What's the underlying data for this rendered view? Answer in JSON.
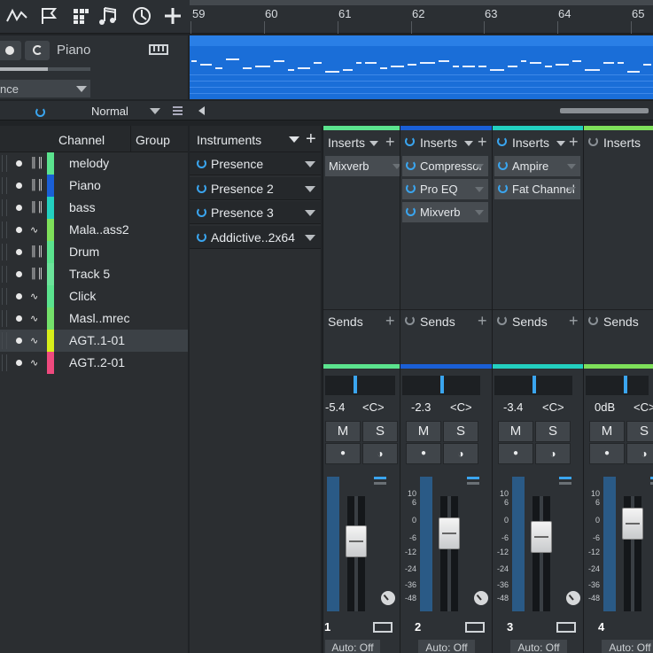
{
  "toolbar": {
    "tools": [
      "automation-icon",
      "marker-flag-icon",
      "grid-icon",
      "note-icon",
      "tempo-icon",
      "add-icon"
    ]
  },
  "track_header": {
    "name": "Piano",
    "preset": "nce"
  },
  "timeline": {
    "bars": [
      "59",
      "60",
      "61",
      "62",
      "63",
      "64",
      "65"
    ]
  },
  "bottom_bar": {
    "mode": "Normal"
  },
  "channel_list": {
    "col_channel": "Channel",
    "col_group": "Group",
    "rows": [
      {
        "name": "melody",
        "type": "instrument",
        "color": "#5be38e"
      },
      {
        "name": "Piano",
        "type": "instrument",
        "color": "#1a5fd6"
      },
      {
        "name": "bass",
        "type": "instrument",
        "color": "#23d0c0"
      },
      {
        "name": "Mala..ass2",
        "type": "audio",
        "color": "#7ee05a"
      },
      {
        "name": "Drum",
        "type": "instrument",
        "color": "#5be38e"
      },
      {
        "name": "Track 5",
        "type": "instrument",
        "color": "#6be39a"
      },
      {
        "name": "Click",
        "type": "audio",
        "color": "#5be38e"
      },
      {
        "name": "Masl..mrec",
        "type": "audio",
        "color": "#74e06a"
      },
      {
        "name": "AGT..1-01",
        "type": "audio",
        "color": "#d8ee1a",
        "selected": true
      },
      {
        "name": "AGT..2-01",
        "type": "audio",
        "color": "#ef4a7e"
      }
    ]
  },
  "instruments": {
    "title": "Instruments",
    "items": [
      "Presence",
      "Presence 2",
      "Presence 3",
      "Addictive..2x64"
    ]
  },
  "mixer": {
    "inserts_label": "Inserts",
    "sends_label": "Sends",
    "mute": "M",
    "solo": "S",
    "pan": "<C>",
    "auto": "Auto: Off",
    "scale": [
      "10",
      "6",
      "0",
      "-6",
      "-12",
      "-24",
      "-36",
      "-48"
    ],
    "strips": [
      {
        "color": "#5be38e",
        "inserts": [
          "Mixverb"
        ],
        "volume": "-5.4",
        "number": "1",
        "power_active": false,
        "fader_level": 0.67
      },
      {
        "color": "#1a5fd6",
        "inserts": [
          "Compressor",
          "Pro EQ",
          "Mixverb"
        ],
        "volume": "-2.3",
        "number": "2",
        "power_active": true,
        "fader_level": 0.74
      },
      {
        "color": "#23d0c0",
        "inserts": [
          "Ampire",
          "Fat Channel"
        ],
        "volume": "-3.4",
        "number": "3",
        "power_active": true,
        "fader_level": 0.71
      },
      {
        "color": "#7ee05a",
        "inserts": [],
        "volume": "0dB",
        "number": "4",
        "power_active": false,
        "fader_level": 0.82
      }
    ]
  }
}
